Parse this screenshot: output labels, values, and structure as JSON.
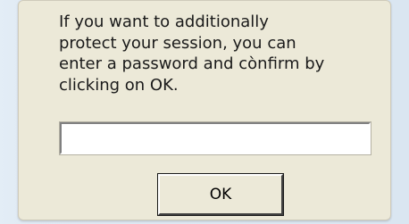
{
  "dialog": {
    "message": "If you want to additionally\nprotect your session, you can\nenter a password and cònfirm by\nclicking on OK.",
    "password_value": "",
    "ok_label": "OK"
  },
  "colors": {
    "dialog_background": "#ece9d8",
    "page_background": "#dfe9f3"
  }
}
